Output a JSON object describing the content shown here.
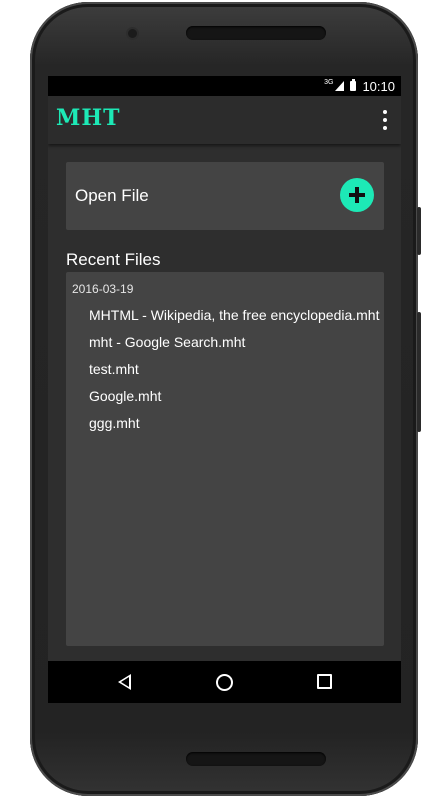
{
  "status_bar": {
    "network": "3G",
    "time": "10:10"
  },
  "app_bar": {
    "title": "MHT",
    "overflow_icon": "more-vert-icon",
    "accent_color": "#1de9b6"
  },
  "open_file": {
    "label": "Open File",
    "icon": "add-circle-icon"
  },
  "recent": {
    "title": "Recent Files",
    "date": "2016-03-19",
    "files": [
      "MHTML - Wikipedia, the free encyclopedia.mht",
      "mht - Google Search.mht",
      "test.mht",
      "Google.mht",
      "ggg.mht"
    ]
  },
  "nav_bar": {
    "back_icon": "back-triangle-icon",
    "home_icon": "home-circle-icon",
    "recents_icon": "recents-square-icon"
  }
}
